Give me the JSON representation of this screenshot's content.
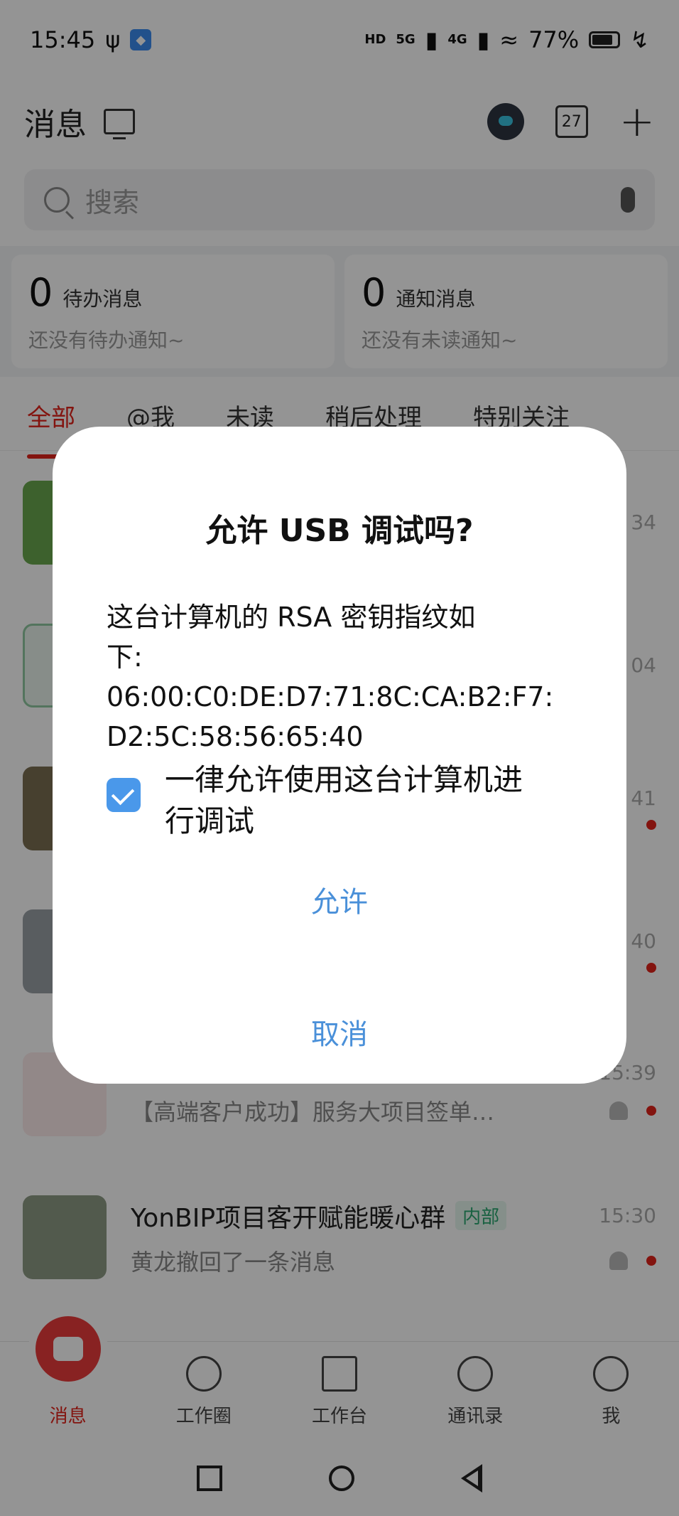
{
  "status_bar": {
    "time": "15:45",
    "battery": "77%",
    "network_1": "5G",
    "network_2": "4G",
    "hd": "HD"
  },
  "header": {
    "title": "消息",
    "calendar_day": "27"
  },
  "search": {
    "placeholder": "搜索"
  },
  "summary": [
    {
      "count": "0",
      "label": "待办消息",
      "sub": "还没有待办通知~"
    },
    {
      "count": "0",
      "label": "通知消息",
      "sub": "还没有未读通知~"
    }
  ],
  "tabs": [
    "全部",
    "@我",
    "未读",
    "稍后处理",
    "特别关注"
  ],
  "conversations": [
    {
      "name": "",
      "time": "34",
      "preview": ""
    },
    {
      "name": "",
      "time": "04",
      "preview": ""
    },
    {
      "name": "",
      "time": "41",
      "preview": ""
    },
    {
      "name": "",
      "time": "40",
      "preview": ""
    },
    {
      "name": "",
      "time": "15:39",
      "preview": "【高端客户成功】服务大项目签单…"
    },
    {
      "name": "YonBIP项目客开赋能暖心群",
      "badge": "内部",
      "time": "15:30",
      "preview": "黄龙撤回了一条消息"
    }
  ],
  "bottom_nav": [
    "消息",
    "工作圈",
    "工作台",
    "通讯录",
    "我"
  ],
  "dialog": {
    "title": "允许 USB 调试吗?",
    "body_line_1": "这台计算机的 RSA 密钥指纹如",
    "body_line_2": "下:",
    "fingerprint_1": "06:00:C0:DE:D7:71:8C:CA:B2:F7:",
    "fingerprint_2": "D2:5C:58:56:65:40",
    "checkbox_label_1": "一律允许使用这台计算机进",
    "checkbox_label_2": "行调试",
    "checkbox_checked": true,
    "allow_label": "允许",
    "cancel_label": "取消"
  },
  "colors": {
    "accent_red": "#e2231a",
    "dialog_button_blue": "#4a90d9",
    "checkbox_blue": "#4a98ea"
  }
}
